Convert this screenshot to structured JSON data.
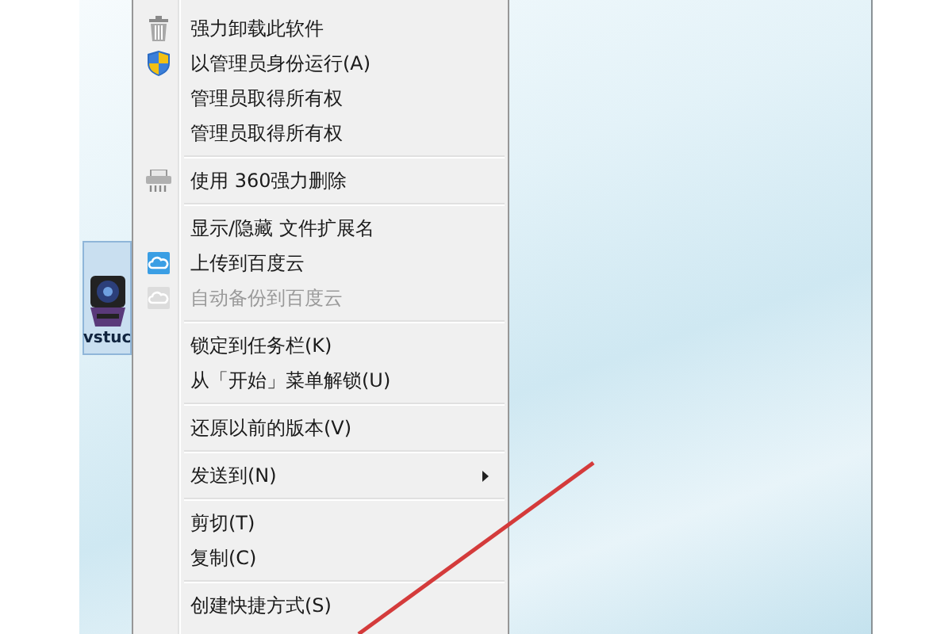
{
  "desktop_icon": {
    "label": "vstuc",
    "selected": true
  },
  "context_menu": {
    "groups": [
      [
        {
          "label": "强力卸载此软件",
          "kind": "trash",
          "disabled": false,
          "submenu": false
        },
        {
          "label": "以管理员身份运行(A)",
          "kind": "shield",
          "disabled": false,
          "submenu": false
        },
        {
          "label": "管理员取得所有权",
          "disabled": false,
          "submenu": false
        },
        {
          "label": "管理员取得所有权",
          "disabled": false,
          "submenu": false
        }
      ],
      [
        {
          "label": "使用 360强力删除",
          "kind": "shredder",
          "disabled": false,
          "submenu": false
        }
      ],
      [
        {
          "label": "显示/隐藏 文件扩展名",
          "disabled": false,
          "submenu": false
        },
        {
          "label": "上传到百度云",
          "kind": "cloud",
          "disabled": false,
          "submenu": false
        },
        {
          "label": "自动备份到百度云",
          "kind": "cloud",
          "disabled": true,
          "submenu": false
        }
      ],
      [
        {
          "label": "锁定到任务栏(K)",
          "disabled": false,
          "submenu": false
        },
        {
          "label": "从「开始」菜单解锁(U)",
          "disabled": false,
          "submenu": false
        }
      ],
      [
        {
          "label": "还原以前的版本(V)",
          "disabled": false,
          "submenu": false
        }
      ],
      [
        {
          "label": "发送到(N)",
          "disabled": false,
          "submenu": true
        }
      ],
      [
        {
          "label": "剪切(T)",
          "disabled": false,
          "submenu": false
        },
        {
          "label": "复制(C)",
          "disabled": false,
          "submenu": false
        }
      ],
      [
        {
          "label": "创建快捷方式(S)",
          "disabled": false,
          "submenu": false
        }
      ]
    ]
  }
}
